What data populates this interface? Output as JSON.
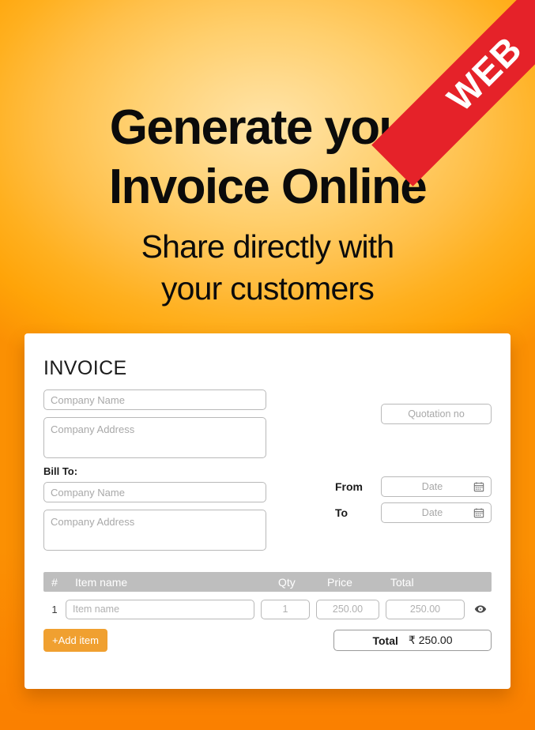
{
  "ribbon": {
    "text": "WEB",
    "color": "#e52229"
  },
  "hero": {
    "title_line1": "Generate your",
    "title_line2": "Invoice Online",
    "sub_line1": "Share directly with",
    "sub_line2": "your customers"
  },
  "invoice": {
    "heading": "INVOICE",
    "seller": {
      "company_name_placeholder": "Company Name",
      "company_address_placeholder": "Company Address"
    },
    "bill_to": {
      "label": "Bill To:",
      "company_name_placeholder": "Company Name",
      "company_address_placeholder": "Company Address"
    },
    "quotation": {
      "placeholder": "Quotation no"
    },
    "dates": {
      "from_label": "From",
      "to_label": "To",
      "from_placeholder": "Date",
      "to_placeholder": "Date",
      "calendar_icon": "calendar-icon"
    },
    "table": {
      "headers": {
        "num": "#",
        "item_name": "Item name",
        "qty": "Qty",
        "price": "Price",
        "total": "Total"
      },
      "rows": [
        {
          "num": "1",
          "item_name_placeholder": "Item name",
          "qty": "1",
          "price": "250.00",
          "total": "250.00",
          "preview_icon": "eye-icon"
        }
      ]
    },
    "add_item_label": "+Add item",
    "total": {
      "label": "Total",
      "value": "₹ 250.00"
    }
  }
}
